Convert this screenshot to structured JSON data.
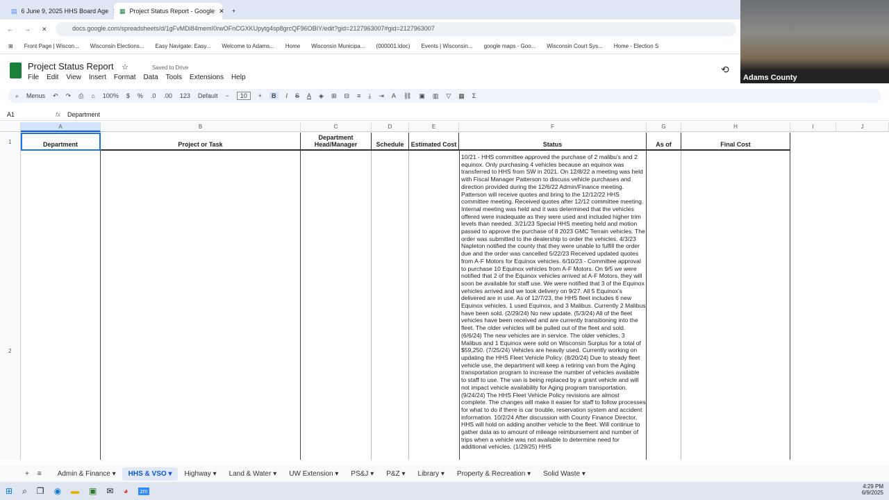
{
  "browser": {
    "tabs": [
      {
        "label": "6 June 9, 2025 HHS Board Age"
      },
      {
        "label": "Project Status Report - Google"
      }
    ],
    "url": "docs.google.com/spreadsheets/d/1gFvMDi84memI0rwOFnCGXKUpytg4sp8grcQF96OBIY/edit?gid=2127963007#gid=2127963007",
    "bookmarks": [
      "Front Page | Wiscon...",
      "Wisconsin Elections...",
      "Easy Navigate: Easy...",
      "Welcome to Adams...",
      "Home",
      "Wisconsin Municipa...",
      "(000001.ldoc)",
      "Events | Wisconsin...",
      "google maps - Goo...",
      "Wisconsin Court Sys...",
      "Home - Election S"
    ]
  },
  "video": {
    "label": "Adams County"
  },
  "doc": {
    "title": "Project Status Report",
    "saved": "Saved to Drive",
    "menus": [
      "File",
      "Edit",
      "View",
      "Insert",
      "Format",
      "Data",
      "Tools",
      "Extensions",
      "Help"
    ]
  },
  "toolbar": {
    "menus": "Menus",
    "zoom": "100%",
    "currency": "$",
    "percent": "%",
    "dec1": ".0",
    "dec2": ".00",
    "num": "123",
    "font": "Default",
    "size": "10"
  },
  "formula": {
    "cell": "A1",
    "fx": "fx",
    "value": "Department"
  },
  "columns": [
    "A",
    "B",
    "C",
    "D",
    "E",
    "F",
    "G",
    "H",
    "I",
    "J"
  ],
  "headers": [
    "Department",
    "Project or Task",
    "Department Head/Manager",
    "Schedule",
    "Estimated Cost",
    "Status",
    "As of",
    "Final Cost"
  ],
  "rows": [
    "1",
    "2"
  ],
  "status": "10/21 - HHS committee approved the purchase of 2 malibu's and 2 equinox. Only purchasing 4 vehicles because an equinox was transferred to HHS from SW in 2021. On 12/8/22 a meeting was held with Fiscal Manager Patterson to discuss vehicle purchases and direction provided during the 12/6/22 Admin/Finance meeting. Patterson will receive quotes and bring to the 12/12/22 HHS committee meeting. Received quotes after 12/12 committee meeting. Internal meeting was held and it was determined that the vehicles offered were inadequate as they were used and included higher trim levels than needed. 3/21/23 Special HHS meeting held and motion passed to approve the purchase of 8 2023 GMC Terrain vehicles. The order was submitted to the dealership to order the vehicles. 4/3/23 Napleton notified the county that they were unable to fulfill the order due and the order was cancelled 5/22/23 Received updated quotes from A-F Motors for Equinox vehicles. 6/10/23 - Committee approval to purchase 10 Equinox vehicles from A-F Motors. On 9/5 we were notified that 2 of the Equinox vehicles arrived at A-F Motors, they will soon be available for staff use. We were notified that 3 of the Equinox vehicles arrived and we took delivery on 9/27. All 5 Equinox's delivered are in use. As of 12/7/23, the HHS fleet includes 6 new Equinox vehicles, 1 used Equinox, and 3 Malibus. Currently 2 Malibus have been sold. (2/29/24) No new update. (5/3/24) All of the fleet vehicles have been received and are currently transitioning into the fleet. The older vehicles will be pulled out of the fleet and sold. (6/6/24) The new vehicles are in service. The older vehicles, 3 Malibus and 1 Equinox were sold on Wisconsin Surplus for a total of $59,250. (7/25/24) Vehicles are heavily used. Currently working on updating the HHS Fleet Vehicle Policy. (8/20/24) Due to steady fleet vehicle use, the department will keep a retiring van from the Aging transportation program to increase the number of vehicles available to staff to use. The van is being replaced by a grant vehicle and will not impact vehicle availability for Aging program transportation. (9/24/24) The HHS Fleet Vehicle Policy revisions are almost complete. The changes will make it easier for staff to follow processes for what to do if there is car trouble, reservation system and accident information. 10/2/24 After discussion with County Finance Director, HHS will hold on adding another vehicle to the fleet. Will continue to gather data as to amount of mileage reimbursement and number of trips when a vehicle was not available to determine need for additional vehicles. (1/29/25) HHS",
  "sheets": [
    "Admin & Finance",
    "HHS & VSO",
    "Highway",
    "Land & Water",
    "UW Extension",
    "PS&J",
    "P&Z",
    "Library",
    "Property & Recreation",
    "Solid Waste"
  ],
  "active_sheet": "HHS & VSO",
  "clock": {
    "time": "4:29 PM",
    "date": "6/9/2025"
  }
}
